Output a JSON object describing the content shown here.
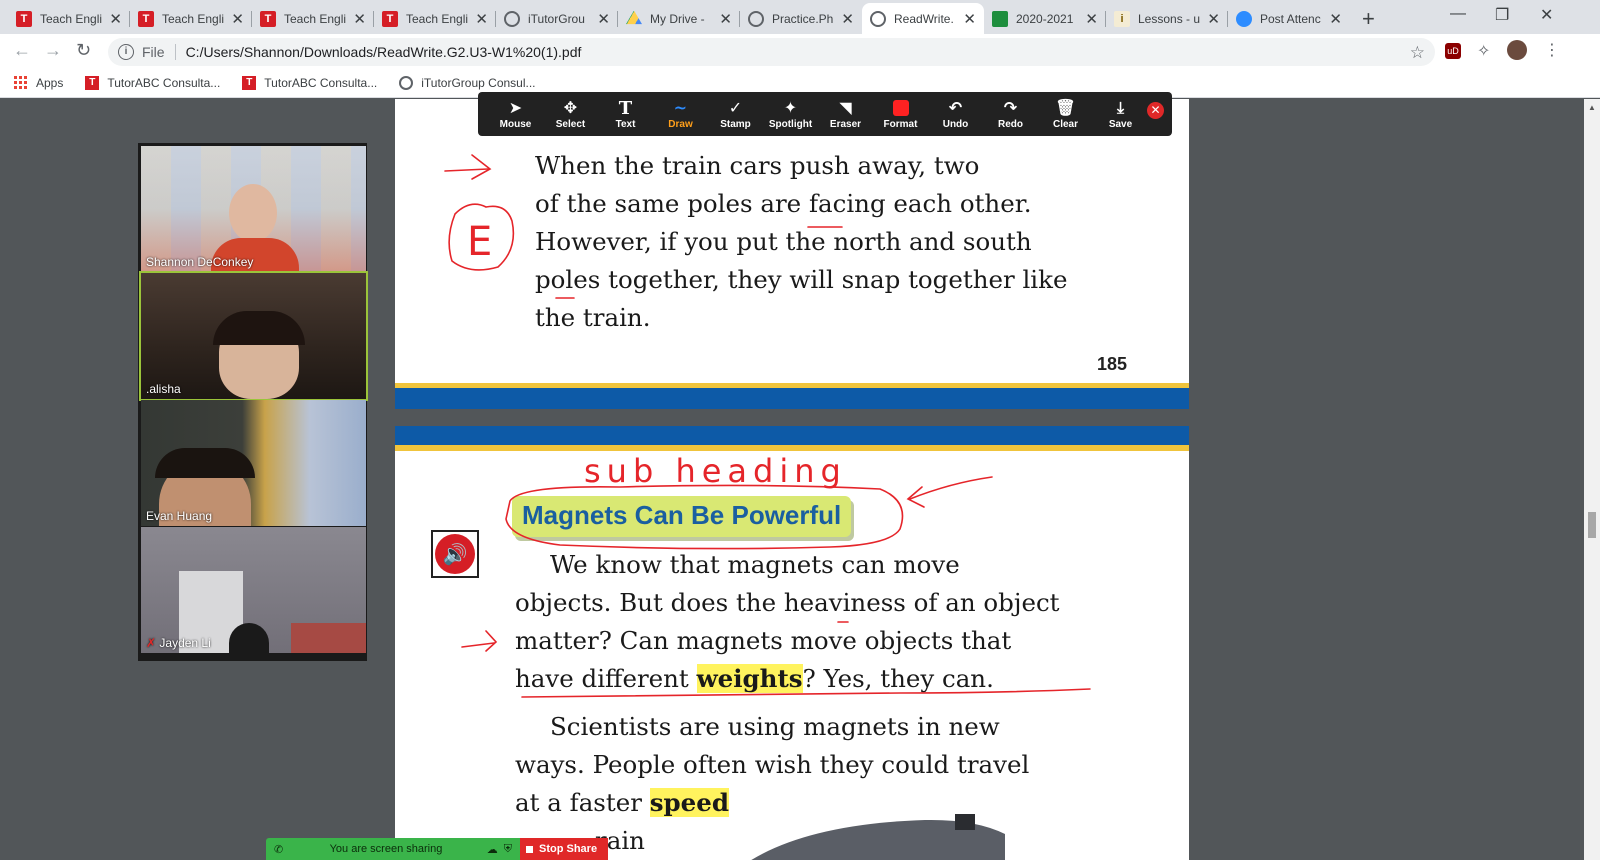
{
  "tabs": [
    {
      "title": "Teach Engli",
      "icon": "tutorabc-icon",
      "active": false
    },
    {
      "title": "Teach Engli",
      "icon": "tutorabc-icon",
      "active": false
    },
    {
      "title": "Teach Engli",
      "icon": "tutorabc-icon",
      "active": false
    },
    {
      "title": "Teach Engli",
      "icon": "tutorabc-icon",
      "active": false
    },
    {
      "title": "iTutorGrou",
      "icon": "globe-icon",
      "active": false
    },
    {
      "title": "My Drive -",
      "icon": "drive-icon",
      "active": false
    },
    {
      "title": "Practice.Ph",
      "icon": "globe-icon",
      "active": false
    },
    {
      "title": "ReadWrite.",
      "icon": "globe-icon",
      "active": true
    },
    {
      "title": "2020-2021",
      "icon": "sheets-icon",
      "active": false
    },
    {
      "title": "Lessons - u",
      "icon": "lesson-icon",
      "active": false
    },
    {
      "title": "Post Attenc",
      "icon": "zoom-icon",
      "active": false
    }
  ],
  "address": {
    "scheme": "File",
    "url": "C:/Users/Shannon/Downloads/ReadWrite.G2.U3-W1%20(1).pdf"
  },
  "bookmarks": [
    {
      "label": "Apps",
      "icon": "apps-grid-icon"
    },
    {
      "label": "TutorABC Consulta...",
      "icon": "tutorabc-icon"
    },
    {
      "label": "TutorABC Consulta...",
      "icon": "tutorabc-icon"
    },
    {
      "label": "iTutorGroup Consul...",
      "icon": "globe-icon"
    }
  ],
  "annotate_toolbar": {
    "tools": [
      {
        "label": "Mouse",
        "icon": "cursor-icon"
      },
      {
        "label": "Select",
        "icon": "move-icon"
      },
      {
        "label": "Text",
        "icon": "text-icon"
      },
      {
        "label": "Draw",
        "icon": "squiggle-icon",
        "selected": true
      },
      {
        "label": "Stamp",
        "icon": "check-icon"
      },
      {
        "label": "Spotlight",
        "icon": "spotlight-icon"
      },
      {
        "label": "Eraser",
        "icon": "eraser-icon"
      },
      {
        "label": "Format",
        "icon": "color-swatch-icon",
        "color": "#ff2222"
      },
      {
        "label": "Undo",
        "icon": "undo-icon"
      },
      {
        "label": "Redo",
        "icon": "redo-icon"
      },
      {
        "label": "Clear",
        "icon": "trash-icon"
      },
      {
        "label": "Save",
        "icon": "save-icon"
      }
    ]
  },
  "page1": {
    "lines": [
      "When the train cars push away, two",
      "of the same poles are facing each other.",
      "However, if you put the north and south",
      "poles together, they will snap together like",
      "the train."
    ],
    "page_number": "185"
  },
  "page2": {
    "subheading": "Magnets Can Be Powerful",
    "para1": {
      "line1": "We know that magnets can move",
      "line2": "objects. But does the heaviness of an object",
      "line3": "matter? Can magnets move objects that",
      "line4_pre": "have different ",
      "line4_hl": "weights",
      "line4_post": "? Yes, they can."
    },
    "para2": {
      "line1": "Scientists are using magnets in new",
      "line2": "ways. People often wish they could travel",
      "line3_pre": "at a faster ",
      "line3_hl": "speed",
      "line4": "rain"
    }
  },
  "annotations": {
    "subheading_note": "sub heading",
    "letter_e": "E"
  },
  "participants": [
    {
      "name": "Shannon DeConkey",
      "muted": false
    },
    {
      "name": ".alisha",
      "muted": false,
      "active_speaker": true
    },
    {
      "name": "Evan Huang",
      "muted": false
    },
    {
      "name": "Jayden Li",
      "muted": true
    }
  ],
  "share_bar": {
    "status": "You are screen sharing",
    "stop_label": "Stop Share"
  },
  "colors": {
    "brand_blue": "#0d5aa7",
    "gold": "#f0c43c",
    "ink_red": "#e5252a",
    "highlight": "#fff35e",
    "share_green": "#3ab44a",
    "stop_red": "#e02828"
  }
}
